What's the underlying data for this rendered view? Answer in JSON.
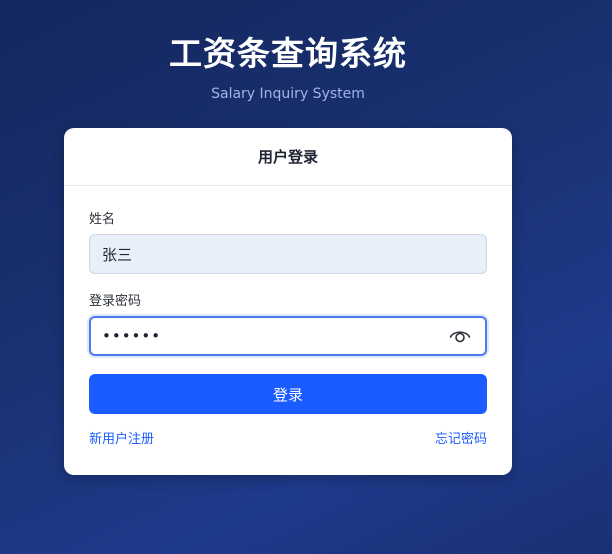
{
  "header": {
    "title": "工资条查询系统",
    "subtitle": "Salary Inquiry System"
  },
  "login_card": {
    "title": "用户登录",
    "name_label": "姓名",
    "name_value": "张三",
    "password_label": "登录密码",
    "password_masked": "••••••",
    "password_toggle_icon": "eye-icon",
    "submit_label": "登录",
    "register_link": "新用户注册",
    "forgot_link": "忘记密码"
  },
  "colors": {
    "primary": "#1a5cff",
    "background": "#1a3273",
    "input_fill": "#e8effb"
  }
}
